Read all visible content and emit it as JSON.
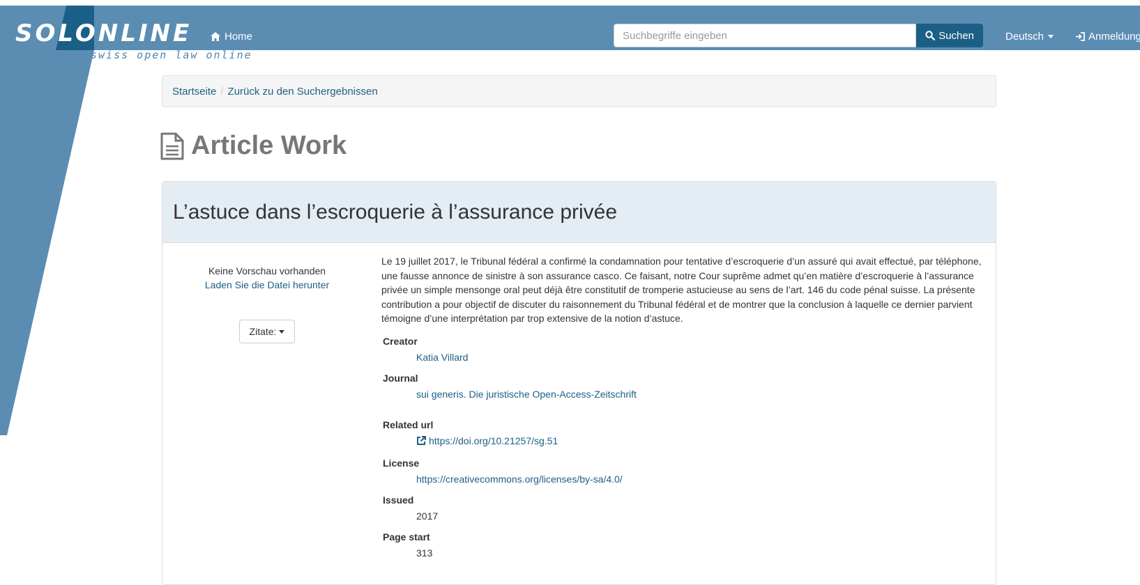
{
  "navbar": {
    "brand_name": "SOLONLINE",
    "tagline": "swiss open law online",
    "home_label": "Home",
    "search_placeholder": "Suchbegriffe eingeben",
    "search_button_label": "Suchen",
    "language_label": "Deutsch",
    "login_label": "Anmeldung"
  },
  "breadcrumb": {
    "items": [
      "Startseite",
      "Zurück zu den Suchergebnissen"
    ]
  },
  "page": {
    "title": "Article Work"
  },
  "article": {
    "title": "L’astuce dans l’escroquerie à l’assurance privée",
    "no_preview": "Keine Vorschau vorhanden",
    "download_link": "Laden Sie die Datei herunter",
    "cite_button": "Zitate:",
    "abstract": "Le 19 juillet 2017, le Tribunal fédéral a confirmé la condamnation pour tentative d’escroquerie d’un assuré qui avait effectué, par téléphone, une fausse annonce de sinistre à son assurance casco. Ce faisant, notre Cour suprême admet qu’en matière d’escroquerie à l’assurance privée un simple mensonge oral peut déjà être constitutif de tromperie astucieuse au sens de l’art. 146 du code pénal suisse. La présente contribution a pour objectif de discuter du raisonnement du Tribunal fédéral et de montrer que la conclusion à laquelle ce dernier parvient témoigne d’une interprétation par trop extensive de la notion d’astuce.",
    "fields": {
      "creator_label": "Creator",
      "creator_value": "Katia Villard",
      "journal_label": "Journal",
      "journal_value": "sui generis. Die juristische Open-Access-Zeitschrift",
      "related_url_label": "Related url",
      "related_url_value": "https://doi.org/10.21257/sg.51",
      "license_label": "License",
      "license_value": "https://creativecommons.org/licenses/by-sa/4.0/",
      "issued_label": "Issued",
      "issued_value": "2017",
      "page_start_label": "Page start",
      "page_start_value": "313"
    }
  },
  "colors": {
    "navbar_blue": "#5b8db3",
    "link_blue": "#1c5f86",
    "search_button": "#1c5f86",
    "heading_bg": "#e4ecf4"
  }
}
